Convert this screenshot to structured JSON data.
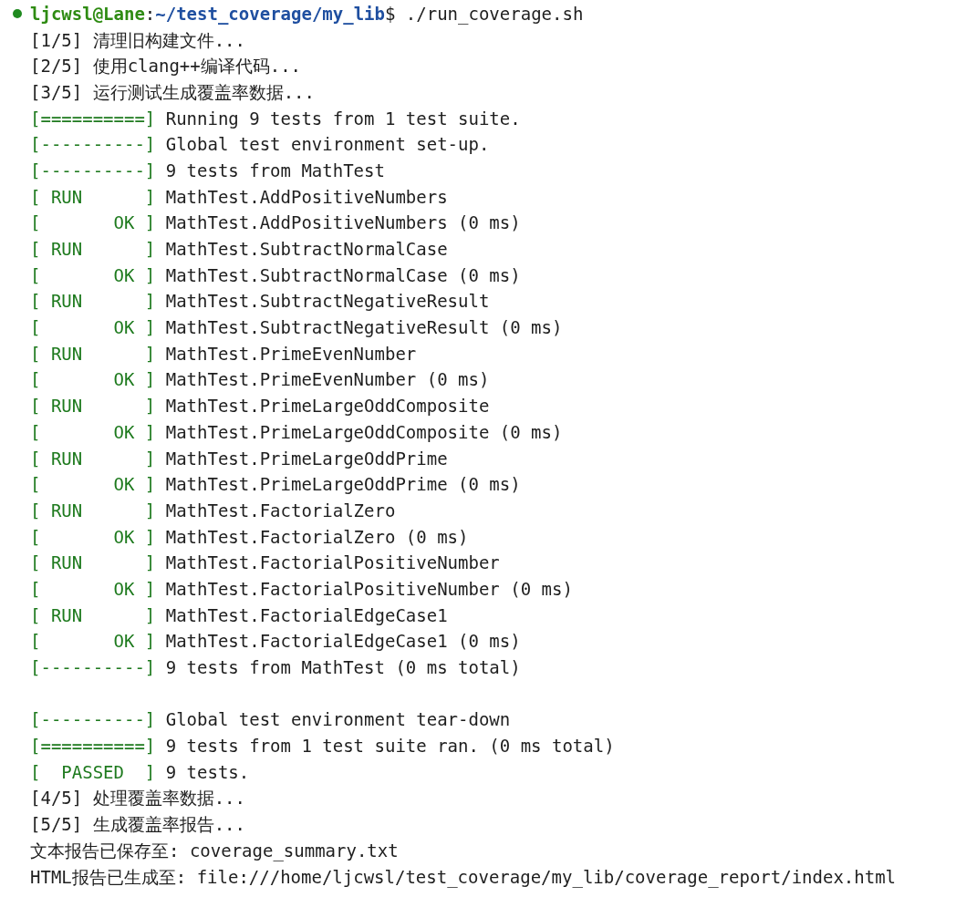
{
  "prompt": {
    "user_host": "ljcwsl@Lane",
    "separator": ":",
    "path": "~/test_coverage/my_lib",
    "symbol": "$",
    "command": " ./run_coverage.sh"
  },
  "lines": [
    {
      "kind": "plain",
      "text": "[1/5] 清理旧构建文件..."
    },
    {
      "kind": "plain",
      "text": "[2/5] 使用clang++编译代码..."
    },
    {
      "kind": "plain",
      "text": "[3/5] 运行测试生成覆盖率数据..."
    },
    {
      "kind": "tagged",
      "tag": "[==========]",
      "text": " Running 9 tests from 1 test suite."
    },
    {
      "kind": "tagged",
      "tag": "[----------]",
      "text": " Global test environment set-up."
    },
    {
      "kind": "tagged",
      "tag": "[----------]",
      "text": " 9 tests from MathTest"
    },
    {
      "kind": "tagged",
      "tag": "[ RUN      ]",
      "text": " MathTest.AddPositiveNumbers"
    },
    {
      "kind": "tagged",
      "tag": "[       OK ]",
      "text": " MathTest.AddPositiveNumbers (0 ms)"
    },
    {
      "kind": "tagged",
      "tag": "[ RUN      ]",
      "text": " MathTest.SubtractNormalCase"
    },
    {
      "kind": "tagged",
      "tag": "[       OK ]",
      "text": " MathTest.SubtractNormalCase (0 ms)"
    },
    {
      "kind": "tagged",
      "tag": "[ RUN      ]",
      "text": " MathTest.SubtractNegativeResult"
    },
    {
      "kind": "tagged",
      "tag": "[       OK ]",
      "text": " MathTest.SubtractNegativeResult (0 ms)"
    },
    {
      "kind": "tagged",
      "tag": "[ RUN      ]",
      "text": " MathTest.PrimeEvenNumber"
    },
    {
      "kind": "tagged",
      "tag": "[       OK ]",
      "text": " MathTest.PrimeEvenNumber (0 ms)"
    },
    {
      "kind": "tagged",
      "tag": "[ RUN      ]",
      "text": " MathTest.PrimeLargeOddComposite"
    },
    {
      "kind": "tagged",
      "tag": "[       OK ]",
      "text": " MathTest.PrimeLargeOddComposite (0 ms)"
    },
    {
      "kind": "tagged",
      "tag": "[ RUN      ]",
      "text": " MathTest.PrimeLargeOddPrime"
    },
    {
      "kind": "tagged",
      "tag": "[       OK ]",
      "text": " MathTest.PrimeLargeOddPrime (0 ms)"
    },
    {
      "kind": "tagged",
      "tag": "[ RUN      ]",
      "text": " MathTest.FactorialZero"
    },
    {
      "kind": "tagged",
      "tag": "[       OK ]",
      "text": " MathTest.FactorialZero (0 ms)"
    },
    {
      "kind": "tagged",
      "tag": "[ RUN      ]",
      "text": " MathTest.FactorialPositiveNumber"
    },
    {
      "kind": "tagged",
      "tag": "[       OK ]",
      "text": " MathTest.FactorialPositiveNumber (0 ms)"
    },
    {
      "kind": "tagged",
      "tag": "[ RUN      ]",
      "text": " MathTest.FactorialEdgeCase1"
    },
    {
      "kind": "tagged",
      "tag": "[       OK ]",
      "text": " MathTest.FactorialEdgeCase1 (0 ms)"
    },
    {
      "kind": "tagged",
      "tag": "[----------]",
      "text": " 9 tests from MathTest (0 ms total)"
    },
    {
      "kind": "blank"
    },
    {
      "kind": "tagged",
      "tag": "[----------]",
      "text": " Global test environment tear-down"
    },
    {
      "kind": "tagged",
      "tag": "[==========]",
      "text": " 9 tests from 1 test suite ran. (0 ms total)"
    },
    {
      "kind": "tagged",
      "tag": "[  PASSED  ]",
      "text": " 9 tests."
    },
    {
      "kind": "plain",
      "text": "[4/5] 处理覆盖率数据..."
    },
    {
      "kind": "plain",
      "text": "[5/5] 生成覆盖率报告..."
    },
    {
      "kind": "plain",
      "text": "文本报告已保存至: coverage_summary.txt"
    },
    {
      "kind": "plain",
      "text": "HTML报告已生成至: file:///home/ljcwsl/test_coverage/my_lib/coverage_report/index.html"
    }
  ]
}
